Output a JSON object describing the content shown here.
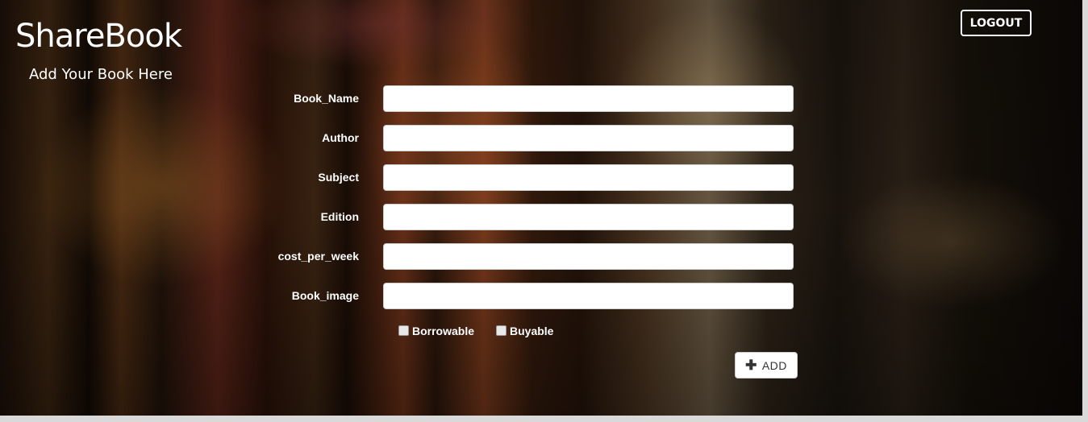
{
  "header": {
    "brand": "ShareBook",
    "subtitle": "Add Your Book Here",
    "logout_label": "LOGOUT"
  },
  "form": {
    "fields": [
      {
        "label": "Book_Name",
        "value": ""
      },
      {
        "label": "Author",
        "value": ""
      },
      {
        "label": "Subject",
        "value": ""
      },
      {
        "label": "Edition",
        "value": ""
      },
      {
        "label": "cost_per_week",
        "value": ""
      },
      {
        "label": "Book_image",
        "value": ""
      }
    ],
    "checkboxes": [
      {
        "label": "Borrowable",
        "checked": false
      },
      {
        "label": "Buyable",
        "checked": false
      }
    ],
    "add_label": "ADD",
    "add_icon": "plus-icon"
  }
}
